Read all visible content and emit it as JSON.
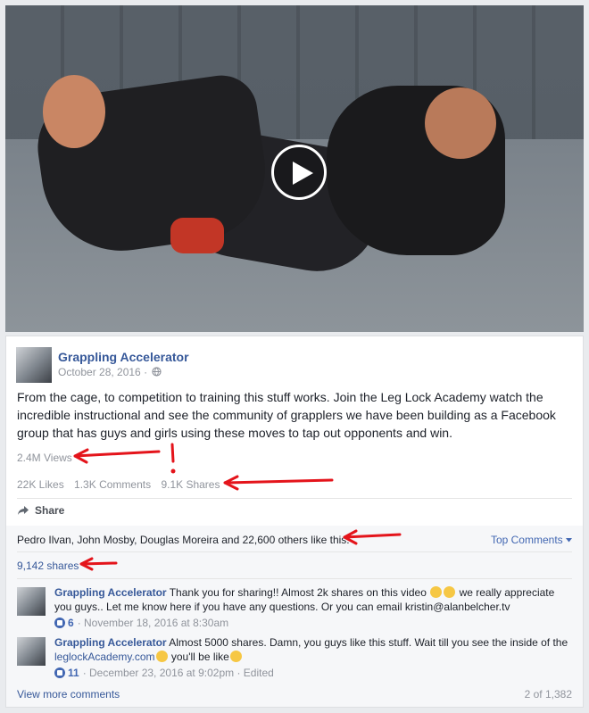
{
  "post": {
    "page_name": "Grappling Accelerator",
    "date": "October 28, 2016 ·",
    "privacy_icon": "globe-icon",
    "text": "From the cage, to competition to training this stuff works. Join the Leg Lock Academy watch the incredible instructional and see the community of grapplers we have been building as a Facebook group that has guys and girls using these moves to tap out opponents and win.",
    "views": "2.4M Views",
    "likes": "22K Likes",
    "comments": "1.3K Comments",
    "shares": "9.1K Shares",
    "share_label": "Share"
  },
  "engagement": {
    "likes_line": "Pedro Ilvan, John Mosby, Douglas Moreira and 22,600 others like this.",
    "top_comments": "Top Comments",
    "shares_link": "9,142 shares"
  },
  "comments": [
    {
      "author": "Grappling Accelerator",
      "text_a": "Thank you for sharing!! Almost 2k shares on this video",
      "text_b": "we really appreciate you guys.. Let me know here if you have any questions. Or you can email kristin@alanbelcher.tv",
      "likes": "6",
      "meta": "· November 18, 2016 at 8:30am"
    },
    {
      "author": "Grappling Accelerator",
      "text_a": "Almost 5000 shares. Damn, you guys like this stuff. Wait till you see the inside of the",
      "link": "leglockAcademy.com",
      "text_b": "you'll be like",
      "likes": "11",
      "meta": "· December 23, 2016 at 9:02pm · Edited"
    }
  ],
  "footer": {
    "view_more": "View more comments",
    "count": "2 of 1,382"
  },
  "colors": {
    "link": "#365899",
    "annotation": "#e4141b",
    "background": "#e9ebee"
  }
}
